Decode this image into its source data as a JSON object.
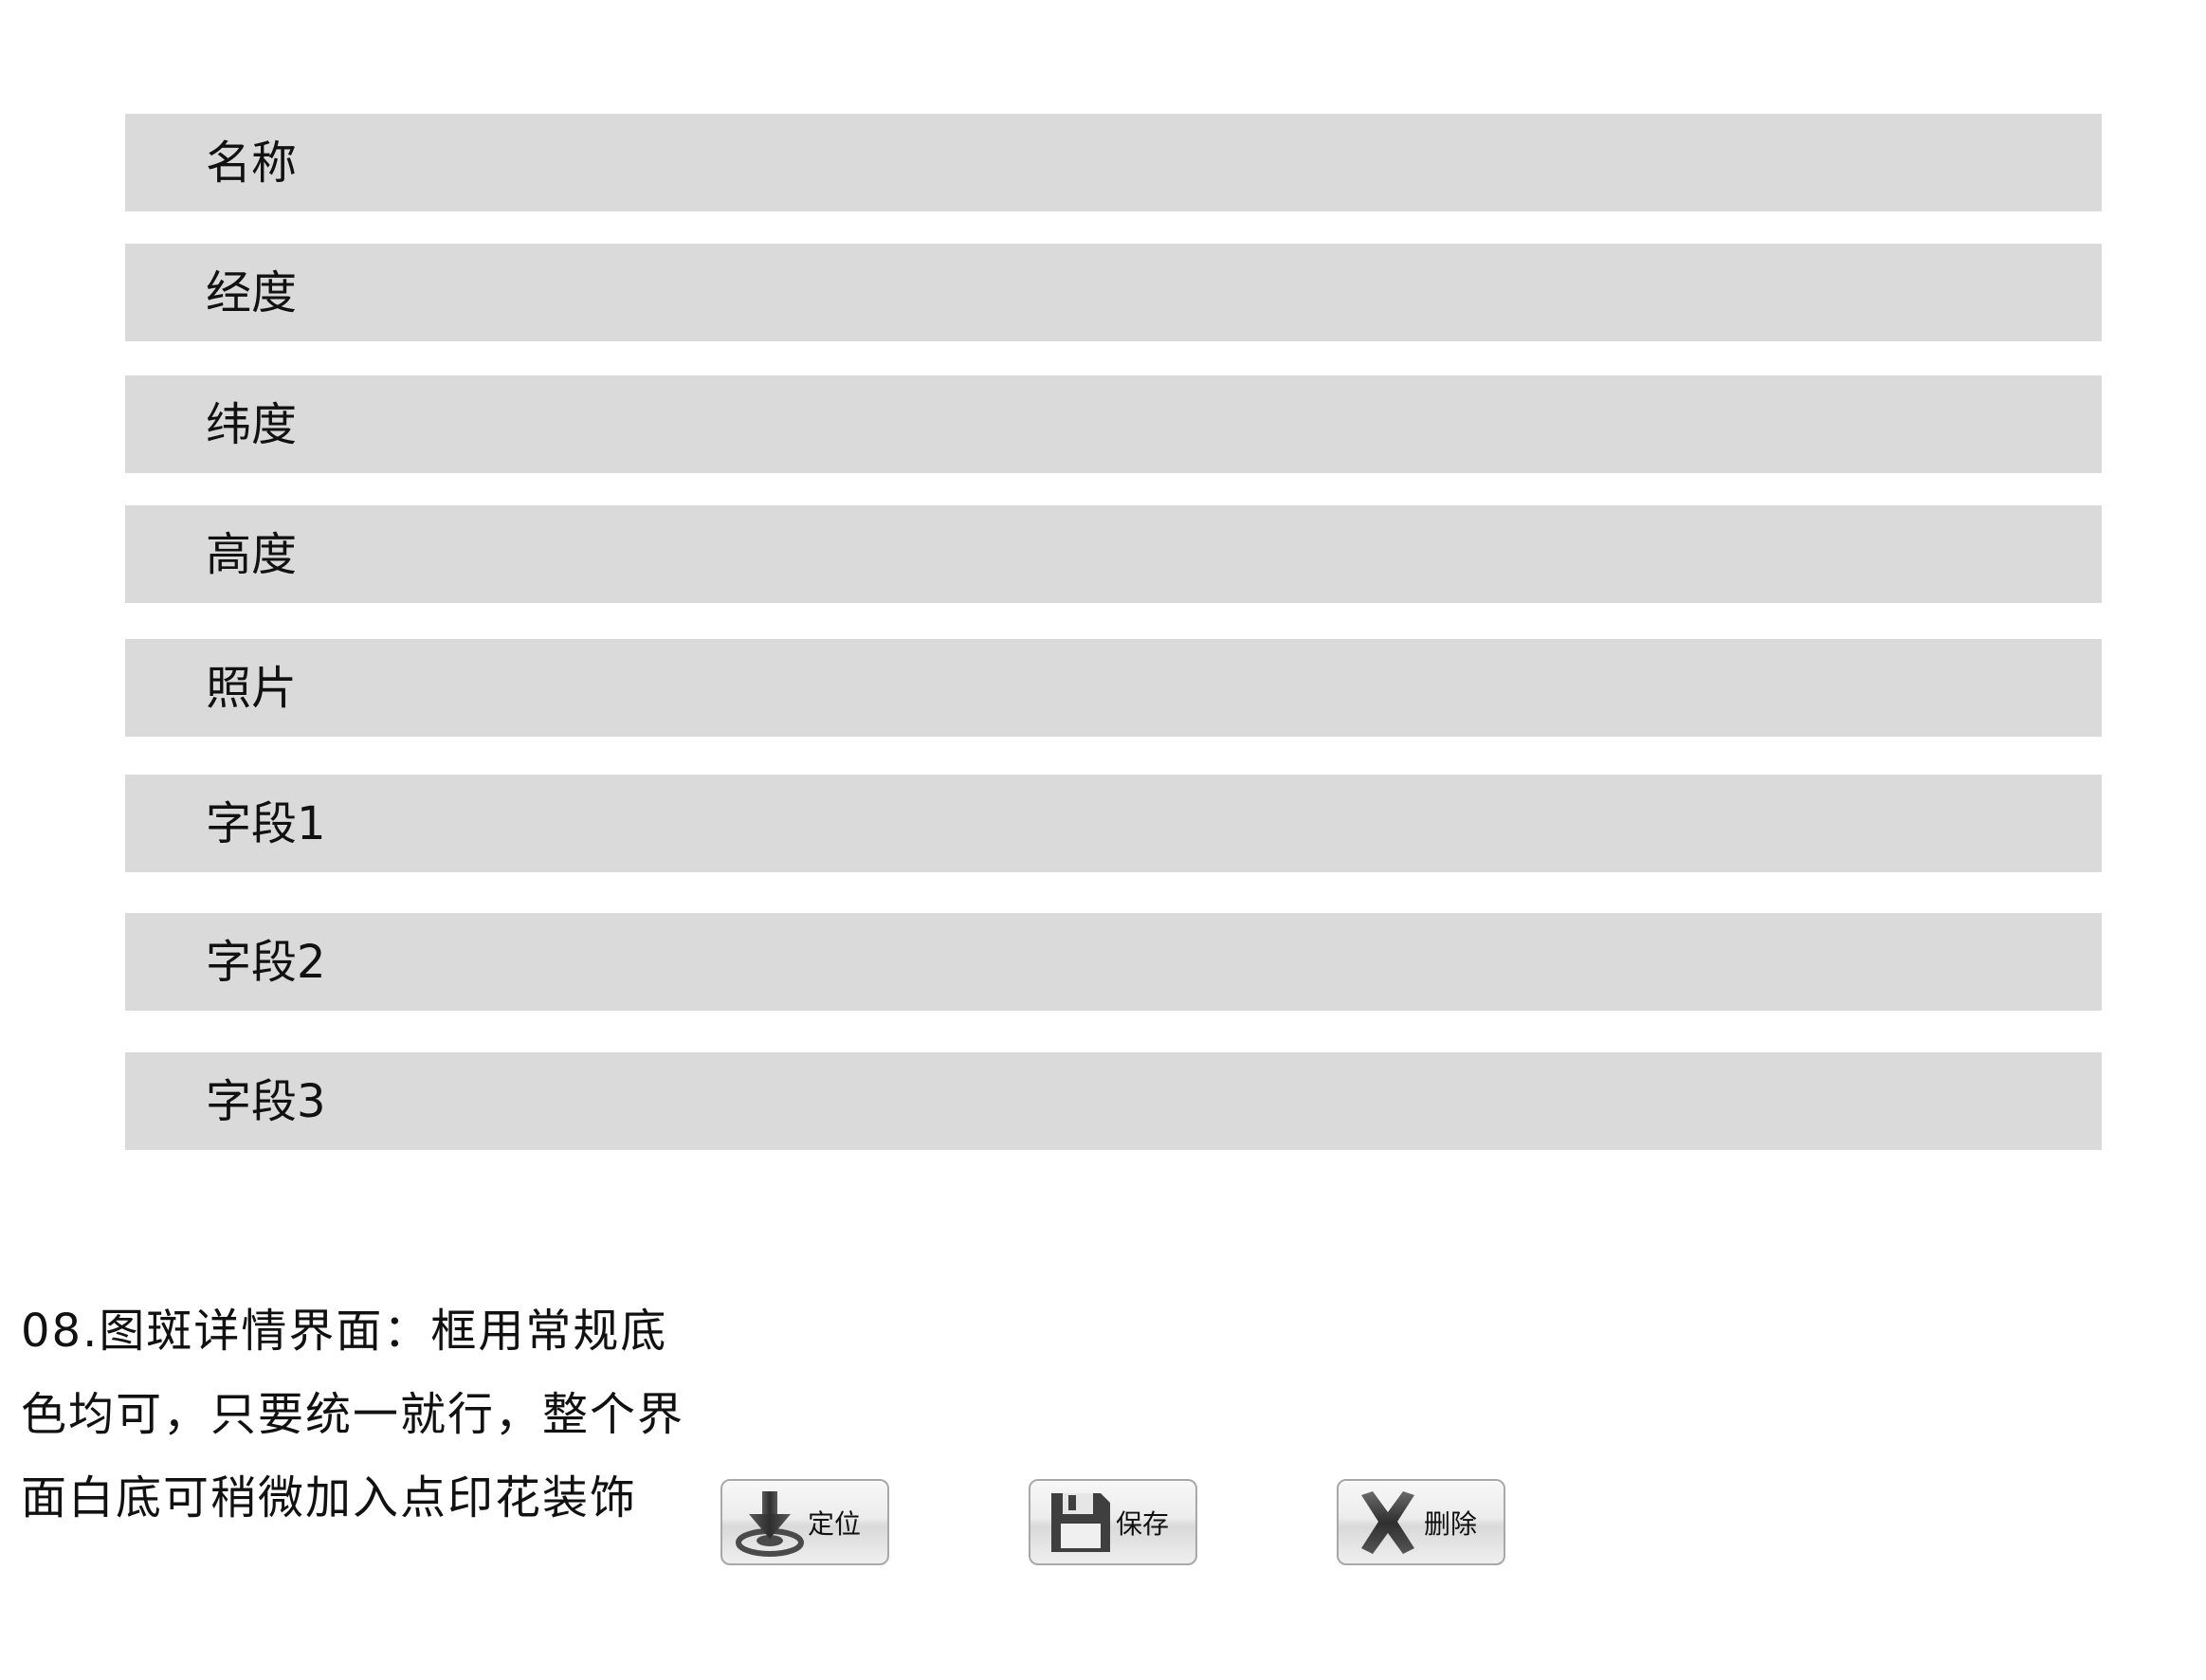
{
  "fields": [
    {
      "label": "名称"
    },
    {
      "label": "经度"
    },
    {
      "label": "纬度"
    },
    {
      "label": "高度"
    },
    {
      "label": "照片"
    },
    {
      "label": "字段1"
    },
    {
      "label": "字段2"
    },
    {
      "label": "字段3"
    }
  ],
  "description": {
    "lines": [
      "08.图斑详情界面：框用常规底",
      "色均可，只要统一就行，整个界",
      "面白底可稍微加入点印花装饰"
    ]
  },
  "buttons": {
    "locate": {
      "label": "定位",
      "icon": "locate-download-icon"
    },
    "save": {
      "label": "保存",
      "icon": "floppy-disk-icon"
    },
    "delete": {
      "label": "删除",
      "icon": "x-close-icon"
    }
  },
  "colors": {
    "field_background": "#dadada",
    "page_background": "#ffffff",
    "icon_dark": "#3a3a3a"
  }
}
